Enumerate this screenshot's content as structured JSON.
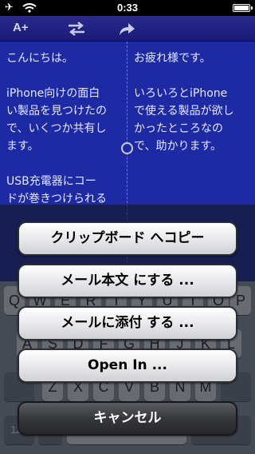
{
  "status_bar": {
    "time": "0:33",
    "airplane_glyph": "✈"
  },
  "toolbar": {
    "font_size_label": "A+",
    "swap_icon": "swap-arrows-icon",
    "share_icon": "share-arrow-icon"
  },
  "editor": {
    "left_text": "こんにちは。\n\niPhone向けの面白\nい製品を見つけたの\nで、いくつか共有し\nます。\n\nUSB充電器にコー\nドが巻きつけられる",
    "right_text": "お疲れ様です。\n\nいろいろとiPhone\nで使える製品が欲し\nかったところなの\nで、助かります。",
    "background_color": "#1e2aa3"
  },
  "keyboard": {
    "row1": [
      "Q",
      "W",
      "E",
      "R",
      "T",
      "Y",
      "U",
      "I",
      "O",
      "P"
    ],
    "row2": [
      "A",
      "S",
      "D",
      "F",
      "G",
      "H",
      "J",
      "K",
      "L"
    ],
    "row3": [
      "Z",
      "X",
      "C",
      "V",
      "B",
      "N",
      "M"
    ],
    "mode_key": "123"
  },
  "action_sheet": {
    "copy_clipboard": "クリップボード へコピー",
    "mail_body": "メール本文 にする ...",
    "mail_attach": "メールに添付 する ...",
    "open_in": "Open In ...",
    "cancel": "キャンセル"
  }
}
